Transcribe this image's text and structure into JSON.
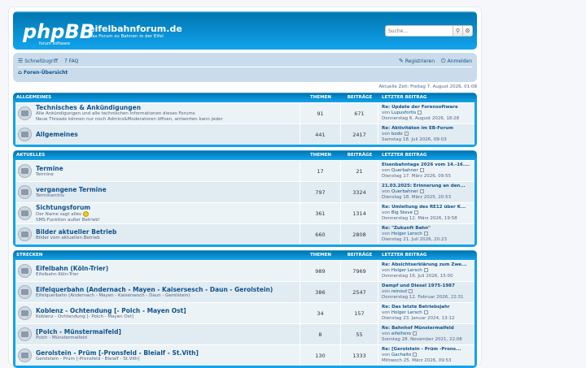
{
  "header": {
    "site_name": "eifelbahnforum.de",
    "site_description": "Das Forum zu Bahnen in der Eifel",
    "logo_text": "phpBB",
    "logo_sub": "forum    software",
    "search_placeholder": "Suche..."
  },
  "nav": {
    "quicklinks": "Schnellzugriff",
    "faq": "FAQ",
    "register": "Registrieren",
    "login": "Anmelden",
    "breadcrumb": "Foren-Übersicht"
  },
  "current_time": "Aktuelle Zeit: Freitag 7. August 2026, 01:08",
  "columns": {
    "topics": "THEMEN",
    "posts": "BEITRÄGE",
    "last": "LETZTER BEITRAG"
  },
  "categories": [
    {
      "name": "ALLGEMEINES",
      "forums": [
        {
          "title": "Technisches & Ankündigungen",
          "desc": [
            "Alle Ankündigungen und alle technischen Informationen dieses Forums",
            "Neue Threads können nur noch Admins&Moderatoren öffnen, antworten kann jeder"
          ],
          "topics": "91",
          "posts": "671",
          "last_title": "Re: Update der Forensoftware",
          "last_by": "Lupusfortis",
          "last_date": "Donnerstag 6. August 2026, 18:28"
        },
        {
          "title": "Allgemeines",
          "desc": [],
          "topics": "441",
          "posts": "2417",
          "last_title": "Re: Aktivitäten im EB-Forum",
          "last_by": "bodo",
          "last_date": "Samstag 18. Juli 2026, 09:03"
        }
      ]
    },
    {
      "name": "AKTUELLES",
      "forums": [
        {
          "title": "Termine",
          "desc": [
            "Termine"
          ],
          "topics": "17",
          "posts": "21",
          "last_title": "Eisenbahntage 2026 vom 14.-16....",
          "last_by": "Querbahner",
          "last_date": "Dienstag 17. März 2026, 09:55"
        },
        {
          "title": "vergangene Termine",
          "desc": [
            "Terminarchiv"
          ],
          "topics": "797",
          "posts": "3324",
          "last_title": "21.03.2025: Erinnerung an den...",
          "last_by": "Querbahner",
          "last_date": "Dienstag 18. März 2025, 20:53"
        },
        {
          "title": "Sichtungsforum",
          "desc": [
            "Der Name sagt alles",
            "SMS-Funktion außer Betrieb!"
          ],
          "smiley": true,
          "topics": "361",
          "posts": "1314",
          "last_title": "Re: Umleitung des RE12 über K...",
          "last_by": "Big Steve",
          "last_date": "Donnerstag 12. März 2026, 19:58"
        },
        {
          "title": "Bilder aktueller Betrieb",
          "desc": [
            "Bilder vom aktuellen Betrieb"
          ],
          "topics": "660",
          "posts": "2808",
          "last_title": "Re: \"Zukunft Bahn\"",
          "last_by": "Holger Lersch",
          "last_date": "Dienstag 21. Juli 2026, 20:23"
        }
      ]
    },
    {
      "name": "STRECKEN",
      "forums": [
        {
          "title": "Eifelbahn (Köln-Trier)",
          "desc": [
            "Eifelbahn Köln-Trier"
          ],
          "topics": "989",
          "posts": "7969",
          "last_title": "Re: Absichtserklärung zum Zwe...",
          "last_by": "Holger Lersch",
          "last_date": "Donnerstag 16. Juli 2026, 15:00"
        },
        {
          "title": "Eifelquerbahn (Andernach - Mayen - Kaisersesch - Daun - Gerolstein)",
          "desc": [
            "Eifelquerbahn (Andernach - Mayen - Kaisersesch - Daun - Gerolstein)"
          ],
          "topics": "386",
          "posts": "2547",
          "last_title": "Dampf und Diesel 1975-1987",
          "last_by": "reinout",
          "last_date": "Donnerstag 12. Februar 2026, 22:31"
        },
        {
          "title": "Koblenz - Ochtendung [- Polch - Mayen Ost]",
          "desc": [
            "Koblenz - Ochtendung [- Polch - Mayen Ost]"
          ],
          "topics": "34",
          "posts": "157",
          "last_title": "Re: Das letzte Betriebsjahr",
          "last_by": "Holger Lersch",
          "last_date": "Dienstag 23. Januar 2024, 13:12"
        },
        {
          "title": "[Polch - Münstermaifeld]",
          "desc": [
            "Polch - Münstermaifeld"
          ],
          "topics": "8",
          "posts": "55",
          "last_title": "Re: Bahnhof Münstermaifeld",
          "last_by": "eifelhero",
          "last_date": "Sonntag 28. November 2021, 22:08"
        },
        {
          "title": "Gerolstein - Prüm [-Pronsfeld - Bleialf - St.Vith]",
          "desc": [
            "Gerolstein - Prüm [-Pronsfeld - Bleialf - St.Vith]"
          ],
          "topics": "130",
          "posts": "1333",
          "last_title": "Re: [Gerolstein - Prüm -Prons...",
          "last_by": "Gachaito",
          "last_date": "Mittwoch 25. März 2026, 09:53"
        }
      ]
    }
  ],
  "labels": {
    "by": "von"
  },
  "colors": {
    "brand": "#12a3eb",
    "link": "#105289",
    "row": "#ecf3f7"
  },
  "icons": [
    "search-icon",
    "advanced-search-icon",
    "menu-icon",
    "faq-icon",
    "register-icon",
    "login-icon",
    "home-icon",
    "forum-read-icon",
    "view-latest-icon"
  ]
}
